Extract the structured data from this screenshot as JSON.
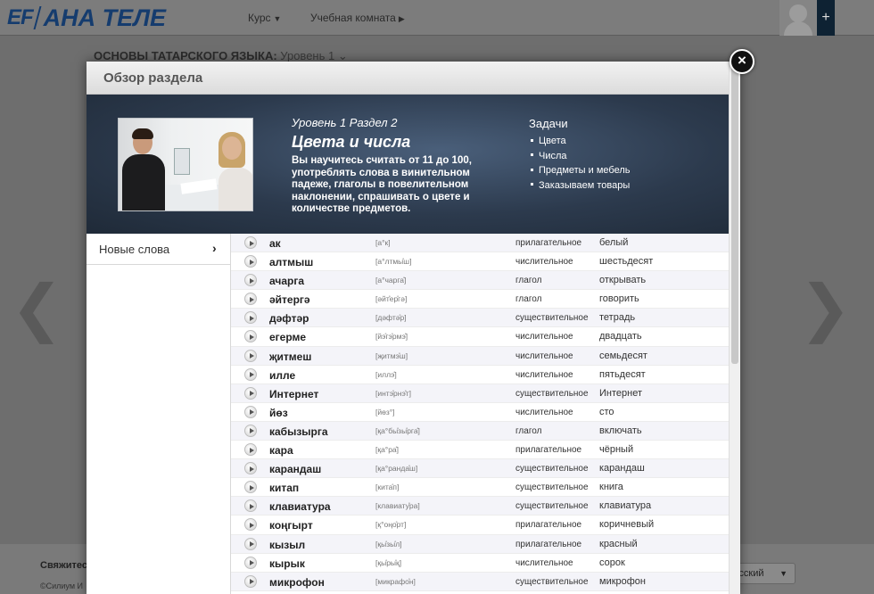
{
  "background": {
    "logo_ef": "EF",
    "logo_text": "АНА ТЕЛЕ",
    "nav_course": "Курс",
    "nav_room": "Учебная комната",
    "plus": "+",
    "course_title": "ОСНОВЫ ТАТАРСКОГО ЯЗЫКА:",
    "course_level": "Уровень 1",
    "footer_contact": "Свяжитес",
    "footer_copy": "©Силиум И",
    "language": "усский"
  },
  "modal": {
    "header": "Обзор раздела",
    "close": "×",
    "banner": {
      "subtitle": "Уровень 1 Раздел 2",
      "title": "Цвета и числа",
      "description": "Вы научитесь считать от 11 до 100, употреблять слова в винительном падеже, глаголы в повелительном наклонении, спрашивать о цвете и количестве предметов.",
      "tasks_title": "Задачи",
      "tasks": [
        "Цвета",
        "Числа",
        "Предметы и мебель",
        "Заказываем товары"
      ]
    },
    "sidebar": {
      "items": [
        {
          "label": "Новые слова"
        }
      ]
    },
    "words": [
      {
        "word": "ак",
        "pron": "[а°к]",
        "pos": "прилагательное",
        "trans": "белый"
      },
      {
        "word": "алтмыш",
        "pron": "[а°лтмы̊ш]",
        "pos": "числительное",
        "trans": "шестьдесят"
      },
      {
        "word": "ачарга",
        "pron": "[а°чарга̊]",
        "pos": "глагол",
        "trans": "открывать"
      },
      {
        "word": "әйтергә",
        "pron": "[әйт̊ер̊гә]",
        "pos": "глагол",
        "trans": "говорить"
      },
      {
        "word": "дәфтәр",
        "pron": "[дәфтә̊р]",
        "pos": "существительное",
        "trans": "тетрадь"
      },
      {
        "word": "егерме",
        "pron": "[йэ̊гэ̊рмэ̊]",
        "pos": "числительное",
        "trans": "двадцать"
      },
      {
        "word": "җитмеш",
        "pron": "[җитмэ̊ш]",
        "pos": "числительное",
        "trans": "семьдесят"
      },
      {
        "word": "илле",
        "pron": "[иллэ̊]",
        "pos": "числительное",
        "trans": "пятьдесят"
      },
      {
        "word": "Интернет",
        "pron": "[интэ̊рнэ̊т]",
        "pos": "существительное",
        "trans": "Интернет"
      },
      {
        "word": "йөз",
        "pron": "[йөз°]",
        "pos": "числительное",
        "trans": "сто"
      },
      {
        "word": "кабызырга",
        "pron": "[қа°бы̊зы̊рга̊]",
        "pos": "глагол",
        "trans": "включать"
      },
      {
        "word": "кара",
        "pron": "[қа°ра̊]",
        "pos": "прилагательное",
        "trans": "чёрный"
      },
      {
        "word": "карандаш",
        "pron": "[қа°ранда̊ш]",
        "pos": "существительное",
        "trans": "карандаш"
      },
      {
        "word": "китап",
        "pron": "[кита̊п]",
        "pos": "существительное",
        "trans": "книга"
      },
      {
        "word": "клавиатура",
        "pron": "[клавиату̊ра]",
        "pos": "существительное",
        "trans": "клавиатура"
      },
      {
        "word": "коңгырт",
        "pron": "[қ°оңо̊рт]",
        "pos": "прилагательное",
        "trans": "коричневый"
      },
      {
        "word": "кызыл",
        "pron": "[қы̊зы̊л]",
        "pos": "прилагательное",
        "trans": "красный"
      },
      {
        "word": "кырык",
        "pron": "[қы̊ры̊қ]",
        "pos": "числительное",
        "trans": "сорок"
      },
      {
        "word": "микрофон",
        "pron": "[микрафо̊н]",
        "pos": "существительное",
        "trans": "микрофон"
      }
    ]
  }
}
